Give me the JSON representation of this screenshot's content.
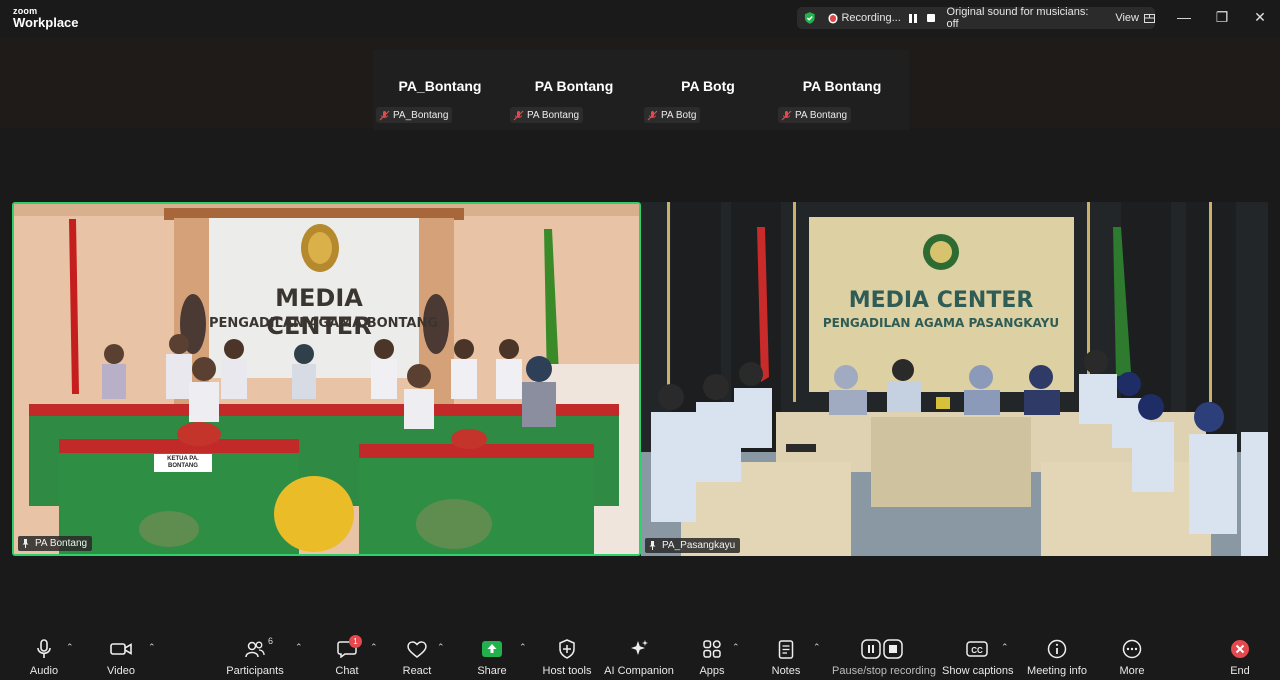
{
  "app": {
    "logo_top": "zoom",
    "logo_bottom": "Workplace"
  },
  "recording": {
    "status": "Recording...",
    "sound_status": "Original sound for musicians: off",
    "view_label": "View"
  },
  "thumbnails": [
    {
      "display_name": "PA_Bontang",
      "tag_name": "PA_Bontang"
    },
    {
      "display_name": "PA Bontang",
      "tag_name": "PA Bontang"
    },
    {
      "display_name": "PA Botg",
      "tag_name": "PA Botg"
    },
    {
      "display_name": "PA Bontang",
      "tag_name": "PA Bontang"
    }
  ],
  "tiles": {
    "left": {
      "name": "PA Bontang",
      "sign_line1": "MEDIA CENTER",
      "sign_line2": "PENGADILAN AGAMA BONTANG",
      "desk_plate": "KETUA PA. BONTANG"
    },
    "right": {
      "name": "PA_Pasangkayu",
      "sign_line1": "MEDIA CENTER",
      "sign_line2": "PENGADILAN AGAMA PASANGKAYU"
    }
  },
  "toolbar": {
    "audio": "Audio",
    "video": "Video",
    "participants": "Participants",
    "participants_count": "6",
    "chat": "Chat",
    "chat_badge": "1",
    "react": "React",
    "share": "Share",
    "host_tools": "Host tools",
    "ai_companion": "AI Companion",
    "apps": "Apps",
    "notes": "Notes",
    "pause_stop": "Pause/stop recording",
    "captions": "Show captions",
    "meeting_info": "Meeting info",
    "more": "More",
    "end": "End"
  },
  "colors": {
    "active_speaker": "#2ed06b",
    "share_green": "#22b14c",
    "end_red": "#e5484d"
  }
}
